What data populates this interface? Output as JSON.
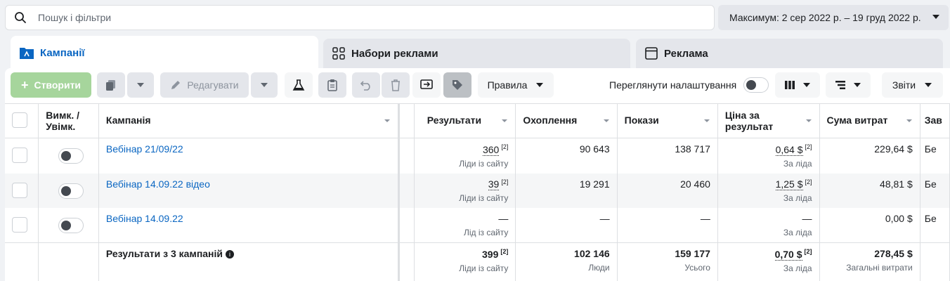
{
  "search": {
    "placeholder": "Пошук і фільтри"
  },
  "date_range": {
    "label": "Максимум: 2 сер 2022 р. – 19 груд 2022 р."
  },
  "tabs": [
    {
      "label": "Кампанії"
    },
    {
      "label": "Набори реклами"
    },
    {
      "label": "Реклама"
    }
  ],
  "toolbar": {
    "create_label": "Створити",
    "edit_label": "Редагувати",
    "rules_label": "Правила",
    "view_settings_label": "Переглянути налаштування",
    "reports_label": "Звіти"
  },
  "table": {
    "columns": {
      "toggle": "Вимк. / Увімк.",
      "campaign": "Кампанія",
      "results": "Результати",
      "reach": "Охоплення",
      "impressions": "Покази",
      "cost_per_result": "Ціна за результат",
      "amount_spent": "Сума витрат",
      "next": "Зав"
    },
    "rows": [
      {
        "name": "Вебінар 21/09/22",
        "results": "360",
        "results_note": "[2]",
        "results_sub": "Ліди із сайту",
        "reach": "90 643",
        "impressions": "138 717",
        "cpr": "0,64 $",
        "cpr_note": "[2]",
        "cpr_sub": "За ліда",
        "spent": "229,64 $",
        "next": "Бе"
      },
      {
        "name": "Вебінар 14.09.22 відео",
        "results": "39",
        "results_note": "[2]",
        "results_sub": "Ліди із сайту",
        "reach": "19 291",
        "impressions": "20 460",
        "cpr": "1,25 $",
        "cpr_note": "[2]",
        "cpr_sub": "За ліда",
        "spent": "48,81 $",
        "next": "Бе"
      },
      {
        "name": "Вебінар 14.09.22",
        "results": "—",
        "results_note": "",
        "results_sub": "Лід із сайту",
        "reach": "—",
        "impressions": "—",
        "cpr": "—",
        "cpr_note": "",
        "cpr_sub": "За ліда",
        "spent": "0,00 $",
        "next": "Бе"
      }
    ],
    "total": {
      "label": "Результати з 3 кампаній",
      "results": "399",
      "results_note": "[2]",
      "results_sub": "Ліди із сайту",
      "reach": "102 146",
      "reach_sub": "Люди",
      "impressions": "159 177",
      "impressions_sub": "Усього",
      "cpr": "0,70 $",
      "cpr_note": "[2]",
      "cpr_sub": "За ліда",
      "spent": "278,45 $",
      "spent_sub": "Загальні витрати"
    }
  },
  "colors": {
    "accent": "#0a66c2",
    "create_bg": "#a6d59c"
  }
}
